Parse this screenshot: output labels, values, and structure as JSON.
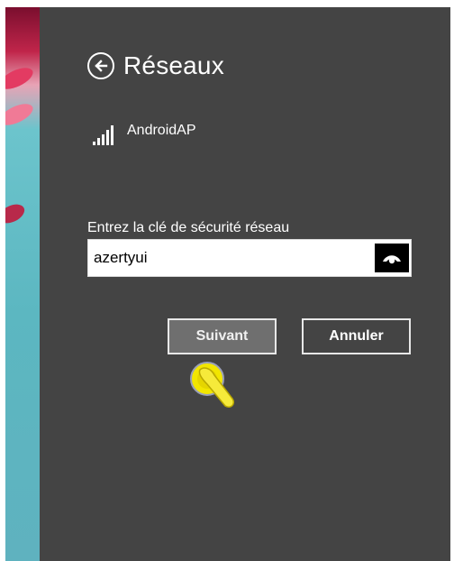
{
  "header": {
    "title": "Réseaux",
    "back_icon": "back-arrow-circle-icon"
  },
  "network": {
    "name": "AndroidAP",
    "signal_icon": "wifi-signal-bars-icon"
  },
  "security_key": {
    "label": "Entrez la clé de sécurité réseau",
    "value": "azertyui",
    "reveal_icon": "eye-reveal-icon"
  },
  "buttons": {
    "next_label": "Suivant",
    "cancel_label": "Annuler"
  },
  "colors": {
    "panel_bg": "#444444",
    "next_bg": "#6f6f6f",
    "touch_indicator": "#f2e600"
  }
}
